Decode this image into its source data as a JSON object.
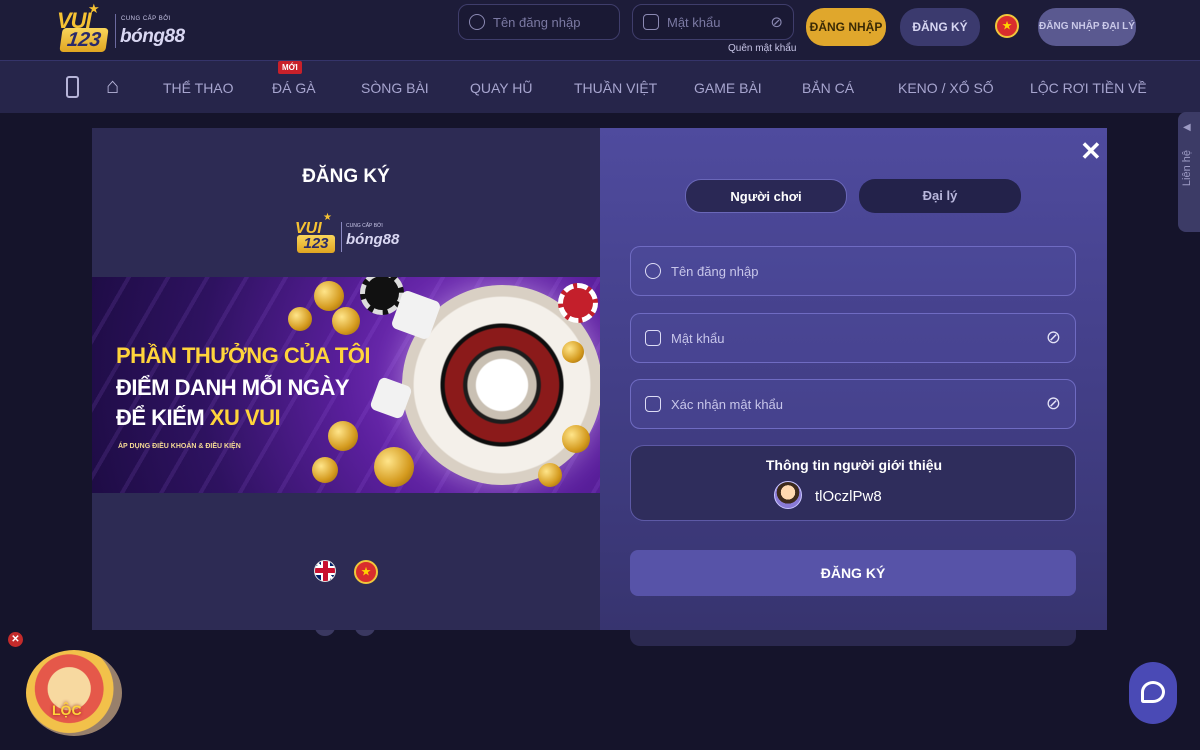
{
  "header": {
    "logo": {
      "vui": "VUI",
      "number": "123",
      "sub": "CUNG CẤP BỞI",
      "brand": "bóng88"
    },
    "username_placeholder": "Tên đăng nhập",
    "password_placeholder": "Mật khẩu",
    "forgot_password": "Quên mật khẩu",
    "login_button": "ĐĂNG NHẬP",
    "register_button": "ĐĂNG KÝ",
    "language_icon": "vietnam-flag",
    "agent_login_button": "ĐĂNG NHẬP ĐẠI LÝ"
  },
  "nav": {
    "items": [
      "THỂ THAO",
      "ĐÁ GÀ",
      "SÒNG BÀI",
      "QUAY HŨ",
      "THUẦN VIỆT",
      "GAME BÀI",
      "BẮN CÁ",
      "KENO / XỔ SỐ",
      "LỘC RƠI TIỀN VỀ"
    ],
    "new_badge": "MỚI"
  },
  "contact_tab": "Liên hệ",
  "modal": {
    "title": "ĐĂNG KÝ",
    "logo": {
      "vui": "VUI",
      "number": "123",
      "sub": "CUNG CẤP BỞI",
      "brand": "bóng88"
    },
    "banner": {
      "line1": "PHẦN THƯỞNG CỦA TÔI",
      "line2": "ĐIỂM DANH MỖI NGÀY",
      "line3_prefix": "ĐỂ KIẾM ",
      "line3_highlight": "XU VUI",
      "terms": "ÁP DỤNG ĐIỀU KHOẢN & ĐIỀU KIỆN"
    },
    "tabs": {
      "player": "Người chơi",
      "agent": "Đại lý"
    },
    "fields": {
      "username_placeholder": "Tên đăng nhập",
      "password_placeholder": "Mật khẩu",
      "confirm_placeholder": "Xác nhận mật khẩu"
    },
    "referrer": {
      "title": "Thông tin người giới thiệu",
      "code": "tlOczlPw8"
    },
    "submit": "ĐĂNG KÝ",
    "close": "✕"
  },
  "promo": {
    "close": "✕",
    "text": "LỘC"
  },
  "colors": {
    "accent_gold": "#e0a72c",
    "modal_right": "#4f4b9e",
    "modal_left": "#2d2b54"
  }
}
